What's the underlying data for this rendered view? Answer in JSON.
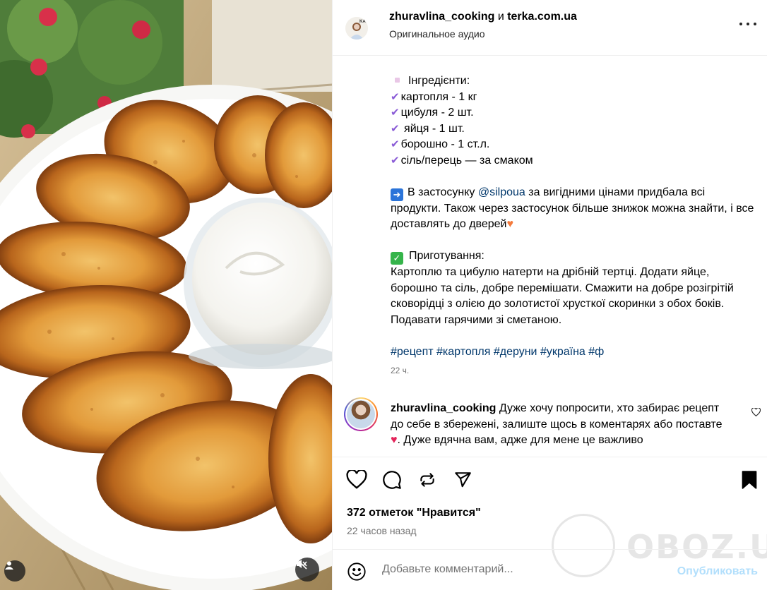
{
  "post": {
    "author": "zhuravlina_cooking",
    "and_word": " и ",
    "collaborator": "terka.com.ua",
    "audio": "Оригинальное аудио"
  },
  "caption": {
    "ingredients_title": "Інгредієнти:",
    "ingredients": [
      "картопля - 1 кг",
      "цибуля - 2 шт.",
      " яйця - 1 шт.",
      "борошно - 1 ст.л.",
      "сіль/перець — за смаком"
    ],
    "p1_before": "В застосунку ",
    "p1_mention": "@silpoua",
    "p1_after": " за вигідними цінами придбала всі продукти. Також через застосунок більше знижок можна знайти, і все доставлять до дверей",
    "prep_title": "Приготування:",
    "prep_text": "Картоплю та цибулю натерти на дрібній тертці. Додати яйце, борошно та сіль, добре перемішати. Смажити на добре розігрітій сковорідці з олією до золотистої хрусткої скоринки з обох боків. Подавати гарячими зі сметаною.",
    "hashtags": "#рецепт #картопля #деруни #україна #ф",
    "time": "22 ч."
  },
  "comment": {
    "author": "zhuravlina_cooking",
    "text": " Дуже хочу попросити, хто забирає рецепт до себе в збережені, залиште щось в коментарях або поставте ",
    "text_after": ". Дуже вдячна вам, адже для мене це важливо"
  },
  "stats": {
    "likes": "372 отметок \"Нравится\"",
    "posted": "22 часов назад"
  },
  "composer": {
    "placeholder": "Добавьте комментарий...",
    "post_label": "Опубликовать"
  },
  "watermark": "OBOZ.UA",
  "colors": {
    "link": "#00376b",
    "check": "#8a5bd6",
    "post_button_disabled": "#b2dffc",
    "secondary_text": "#737373"
  },
  "icons": [
    "more-icon",
    "heart-icon",
    "comment-icon",
    "repost-icon",
    "share-icon",
    "bookmark-icon",
    "emoji-icon",
    "tag-user-icon",
    "mute-icon"
  ]
}
